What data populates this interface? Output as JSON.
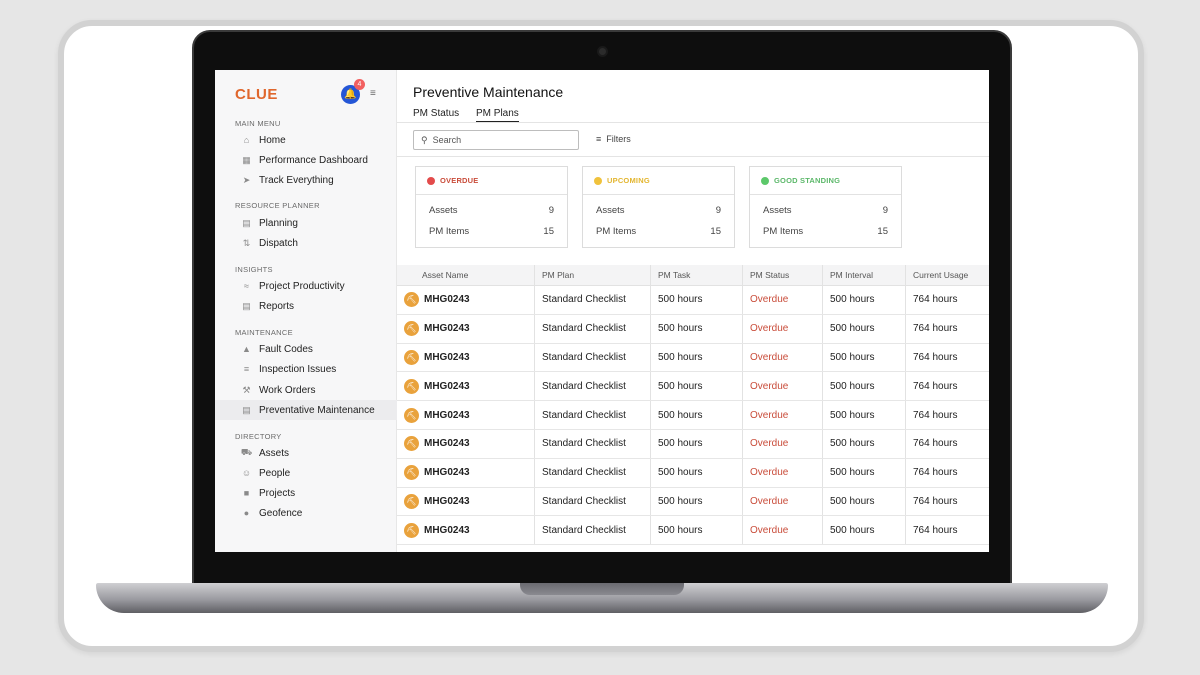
{
  "app": {
    "logo": "CLUE",
    "notification_count": "4"
  },
  "sidebar": {
    "sections": {
      "main_menu": "MAIN MENU",
      "resource_planner": "RESOURCE PLANNER",
      "insights": "INSIGHTS",
      "maintenance": "MAINTENANCE",
      "directory": "DIRECTORY"
    },
    "items": {
      "home": "Home",
      "performance_dashboard": "Performance Dashboard",
      "track_everything": "Track Everything",
      "planning": "Planning",
      "dispatch": "Dispatch",
      "project_productivity": "Project Productivity",
      "reports": "Reports",
      "fault_codes": "Fault Codes",
      "inspection_issues": "Inspection Issues",
      "work_orders": "Work Orders",
      "preventative_maintenance": "Preventative Maintenance",
      "assets": "Assets",
      "people": "People",
      "projects": "Projects",
      "geofence": "Geofence"
    },
    "active_item": "preventative_maintenance"
  },
  "header": {
    "title": "Preventive Maintenance",
    "tabs": [
      "PM Status",
      "PM Plans"
    ],
    "active_tab": "PM Plans"
  },
  "toolbar": {
    "search_placeholder": "Search",
    "filters_label": "Filters"
  },
  "stats": [
    {
      "label": "OVERDUE",
      "color": "#e34b4b",
      "label_color": "#c94c3a",
      "assets_label": "Assets",
      "assets": "9",
      "items_label": "PM Items",
      "items": "15"
    },
    {
      "label": "UPCOMING",
      "color": "#f0c23c",
      "label_color": "#e3b630",
      "assets_label": "Assets",
      "assets": "9",
      "items_label": "PM Items",
      "items": "15"
    },
    {
      "label": "GOOD STANDING",
      "color": "#5cc86a",
      "label_color": "#5cb86a",
      "assets_label": "Assets",
      "assets": "9",
      "items_label": "PM Items",
      "items": "15"
    }
  ],
  "table": {
    "columns": [
      "Asset Name",
      "PM Plan",
      "PM Task",
      "PM Status",
      "PM Interval",
      "Current Usage"
    ],
    "rows": [
      [
        "MHG0243",
        "Standard Checklist",
        "500 hours",
        "Overdue",
        "500 hours",
        "764 hours"
      ],
      [
        "MHG0243",
        "Standard Checklist",
        "500 hours",
        "Overdue",
        "500 hours",
        "764 hours"
      ],
      [
        "MHG0243",
        "Standard Checklist",
        "500 hours",
        "Overdue",
        "500 hours",
        "764 hours"
      ],
      [
        "MHG0243",
        "Standard Checklist",
        "500 hours",
        "Overdue",
        "500 hours",
        "764 hours"
      ],
      [
        "MHG0243",
        "Standard Checklist",
        "500 hours",
        "Overdue",
        "500 hours",
        "764 hours"
      ],
      [
        "MHG0243",
        "Standard Checklist",
        "500 hours",
        "Overdue",
        "500 hours",
        "764 hours"
      ],
      [
        "MHG0243",
        "Standard Checklist",
        "500 hours",
        "Overdue",
        "500 hours",
        "764 hours"
      ],
      [
        "MHG0243",
        "Standard Checklist",
        "500 hours",
        "Overdue",
        "500 hours",
        "764 hours"
      ],
      [
        "MHG0243",
        "Standard Checklist",
        "500 hours",
        "Overdue",
        "500 hours",
        "764 hours"
      ]
    ]
  }
}
